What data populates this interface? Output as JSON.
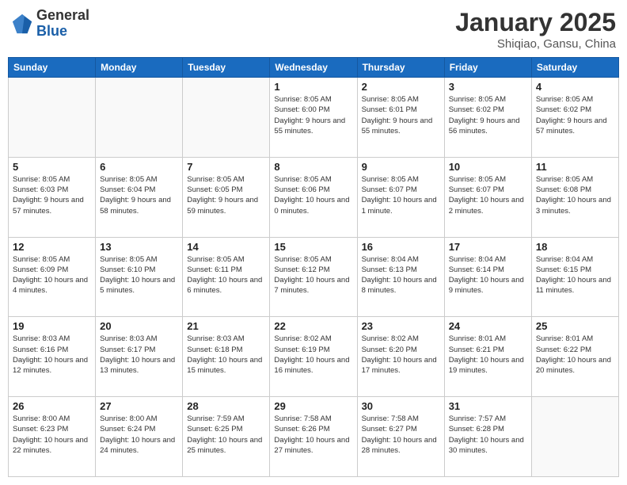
{
  "header": {
    "logo_line1": "General",
    "logo_line2": "Blue",
    "month": "January 2025",
    "location": "Shiqiao, Gansu, China"
  },
  "weekdays": [
    "Sunday",
    "Monday",
    "Tuesday",
    "Wednesday",
    "Thursday",
    "Friday",
    "Saturday"
  ],
  "weeks": [
    [
      {
        "day": "",
        "info": ""
      },
      {
        "day": "",
        "info": ""
      },
      {
        "day": "",
        "info": ""
      },
      {
        "day": "1",
        "info": "Sunrise: 8:05 AM\nSunset: 6:00 PM\nDaylight: 9 hours\nand 55 minutes."
      },
      {
        "day": "2",
        "info": "Sunrise: 8:05 AM\nSunset: 6:01 PM\nDaylight: 9 hours\nand 55 minutes."
      },
      {
        "day": "3",
        "info": "Sunrise: 8:05 AM\nSunset: 6:02 PM\nDaylight: 9 hours\nand 56 minutes."
      },
      {
        "day": "4",
        "info": "Sunrise: 8:05 AM\nSunset: 6:02 PM\nDaylight: 9 hours\nand 57 minutes."
      }
    ],
    [
      {
        "day": "5",
        "info": "Sunrise: 8:05 AM\nSunset: 6:03 PM\nDaylight: 9 hours\nand 57 minutes."
      },
      {
        "day": "6",
        "info": "Sunrise: 8:05 AM\nSunset: 6:04 PM\nDaylight: 9 hours\nand 58 minutes."
      },
      {
        "day": "7",
        "info": "Sunrise: 8:05 AM\nSunset: 6:05 PM\nDaylight: 9 hours\nand 59 minutes."
      },
      {
        "day": "8",
        "info": "Sunrise: 8:05 AM\nSunset: 6:06 PM\nDaylight: 10 hours\nand 0 minutes."
      },
      {
        "day": "9",
        "info": "Sunrise: 8:05 AM\nSunset: 6:07 PM\nDaylight: 10 hours\nand 1 minute."
      },
      {
        "day": "10",
        "info": "Sunrise: 8:05 AM\nSunset: 6:07 PM\nDaylight: 10 hours\nand 2 minutes."
      },
      {
        "day": "11",
        "info": "Sunrise: 8:05 AM\nSunset: 6:08 PM\nDaylight: 10 hours\nand 3 minutes."
      }
    ],
    [
      {
        "day": "12",
        "info": "Sunrise: 8:05 AM\nSunset: 6:09 PM\nDaylight: 10 hours\nand 4 minutes."
      },
      {
        "day": "13",
        "info": "Sunrise: 8:05 AM\nSunset: 6:10 PM\nDaylight: 10 hours\nand 5 minutes."
      },
      {
        "day": "14",
        "info": "Sunrise: 8:05 AM\nSunset: 6:11 PM\nDaylight: 10 hours\nand 6 minutes."
      },
      {
        "day": "15",
        "info": "Sunrise: 8:05 AM\nSunset: 6:12 PM\nDaylight: 10 hours\nand 7 minutes."
      },
      {
        "day": "16",
        "info": "Sunrise: 8:04 AM\nSunset: 6:13 PM\nDaylight: 10 hours\nand 8 minutes."
      },
      {
        "day": "17",
        "info": "Sunrise: 8:04 AM\nSunset: 6:14 PM\nDaylight: 10 hours\nand 9 minutes."
      },
      {
        "day": "18",
        "info": "Sunrise: 8:04 AM\nSunset: 6:15 PM\nDaylight: 10 hours\nand 11 minutes."
      }
    ],
    [
      {
        "day": "19",
        "info": "Sunrise: 8:03 AM\nSunset: 6:16 PM\nDaylight: 10 hours\nand 12 minutes."
      },
      {
        "day": "20",
        "info": "Sunrise: 8:03 AM\nSunset: 6:17 PM\nDaylight: 10 hours\nand 13 minutes."
      },
      {
        "day": "21",
        "info": "Sunrise: 8:03 AM\nSunset: 6:18 PM\nDaylight: 10 hours\nand 15 minutes."
      },
      {
        "day": "22",
        "info": "Sunrise: 8:02 AM\nSunset: 6:19 PM\nDaylight: 10 hours\nand 16 minutes."
      },
      {
        "day": "23",
        "info": "Sunrise: 8:02 AM\nSunset: 6:20 PM\nDaylight: 10 hours\nand 17 minutes."
      },
      {
        "day": "24",
        "info": "Sunrise: 8:01 AM\nSunset: 6:21 PM\nDaylight: 10 hours\nand 19 minutes."
      },
      {
        "day": "25",
        "info": "Sunrise: 8:01 AM\nSunset: 6:22 PM\nDaylight: 10 hours\nand 20 minutes."
      }
    ],
    [
      {
        "day": "26",
        "info": "Sunrise: 8:00 AM\nSunset: 6:23 PM\nDaylight: 10 hours\nand 22 minutes."
      },
      {
        "day": "27",
        "info": "Sunrise: 8:00 AM\nSunset: 6:24 PM\nDaylight: 10 hours\nand 24 minutes."
      },
      {
        "day": "28",
        "info": "Sunrise: 7:59 AM\nSunset: 6:25 PM\nDaylight: 10 hours\nand 25 minutes."
      },
      {
        "day": "29",
        "info": "Sunrise: 7:58 AM\nSunset: 6:26 PM\nDaylight: 10 hours\nand 27 minutes."
      },
      {
        "day": "30",
        "info": "Sunrise: 7:58 AM\nSunset: 6:27 PM\nDaylight: 10 hours\nand 28 minutes."
      },
      {
        "day": "31",
        "info": "Sunrise: 7:57 AM\nSunset: 6:28 PM\nDaylight: 10 hours\nand 30 minutes."
      },
      {
        "day": "",
        "info": ""
      }
    ]
  ]
}
